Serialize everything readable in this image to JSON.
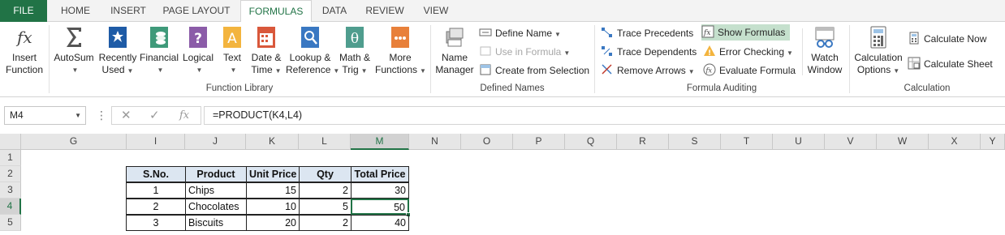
{
  "tabs": {
    "file": "FILE",
    "home": "HOME",
    "insert": "INSERT",
    "page_layout": "PAGE LAYOUT",
    "formulas": "FORMULAS",
    "data": "DATA",
    "review": "REVIEW",
    "view": "VIEW"
  },
  "ribbon": {
    "insert_function": [
      "Insert",
      "Function"
    ],
    "autosum": "AutoSum",
    "recently_used": [
      "Recently",
      "Used"
    ],
    "financial": "Financial",
    "logical": "Logical",
    "text": "Text",
    "date_time": [
      "Date &",
      "Time"
    ],
    "lookup_reference": [
      "Lookup &",
      "Reference"
    ],
    "math_trig": [
      "Math &",
      "Trig"
    ],
    "more_functions": [
      "More",
      "Functions"
    ],
    "function_library_label": "Function Library",
    "name_manager": [
      "Name",
      "Manager"
    ],
    "define_name": "Define Name",
    "use_in_formula": "Use in Formula",
    "create_from_selection": "Create from Selection",
    "defined_names_label": "Defined Names",
    "trace_precedents": "Trace Precedents",
    "trace_dependents": "Trace Dependents",
    "remove_arrows": "Remove Arrows",
    "show_formulas": "Show Formulas",
    "error_checking": "Error Checking",
    "evaluate_formula": "Evaluate Formula",
    "watch_window": [
      "Watch",
      "Window"
    ],
    "formula_auditing_label": "Formula Auditing",
    "calculation_options": [
      "Calculation",
      "Options"
    ],
    "calculate_now": "Calculate Now",
    "calculate_sheet": "Calculate Sheet",
    "calculation_label": "Calculation"
  },
  "formula_bar": {
    "name_box": "M4",
    "formula": "=PRODUCT(K4,L4)"
  },
  "sheet": {
    "columns": [
      "G",
      "I",
      "J",
      "K",
      "L",
      "M",
      "N",
      "O",
      "P",
      "Q",
      "R",
      "S",
      "T",
      "U",
      "V",
      "W",
      "X",
      "Y"
    ],
    "selected_column": "M",
    "rows": [
      "1",
      "2",
      "3",
      "4",
      "5"
    ],
    "selected_row": "4",
    "table_headers": [
      "S.No.",
      "Product",
      "Unit Price",
      "Qty",
      "Total Price"
    ],
    "table_rows": [
      [
        "1",
        "Chips",
        "15",
        "2",
        "30"
      ],
      [
        "2",
        "Chocolates",
        "10",
        "5",
        "50"
      ],
      [
        "3",
        "Biscuits",
        "20",
        "2",
        "40"
      ]
    ],
    "header_fill_color": "#dce6f1",
    "selection_color": "#217346"
  }
}
